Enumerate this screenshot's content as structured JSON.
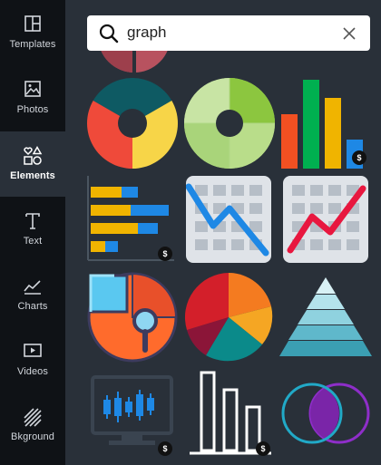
{
  "sidebar": {
    "items": [
      {
        "label": "Templates",
        "icon": "templates-icon"
      },
      {
        "label": "Photos",
        "icon": "photos-icon"
      },
      {
        "label": "Elements",
        "icon": "elements-icon",
        "active": true
      },
      {
        "label": "Text",
        "icon": "text-icon"
      },
      {
        "label": "Charts",
        "icon": "charts-icon"
      },
      {
        "label": "Videos",
        "icon": "videos-icon"
      },
      {
        "label": "Bkground",
        "icon": "background-icon"
      }
    ]
  },
  "search": {
    "value": "graph"
  },
  "badge_label": "$",
  "colors": {
    "sidebar_bg": "#0f1216",
    "panel_bg": "#293039",
    "accent": "#1b8fa3"
  }
}
